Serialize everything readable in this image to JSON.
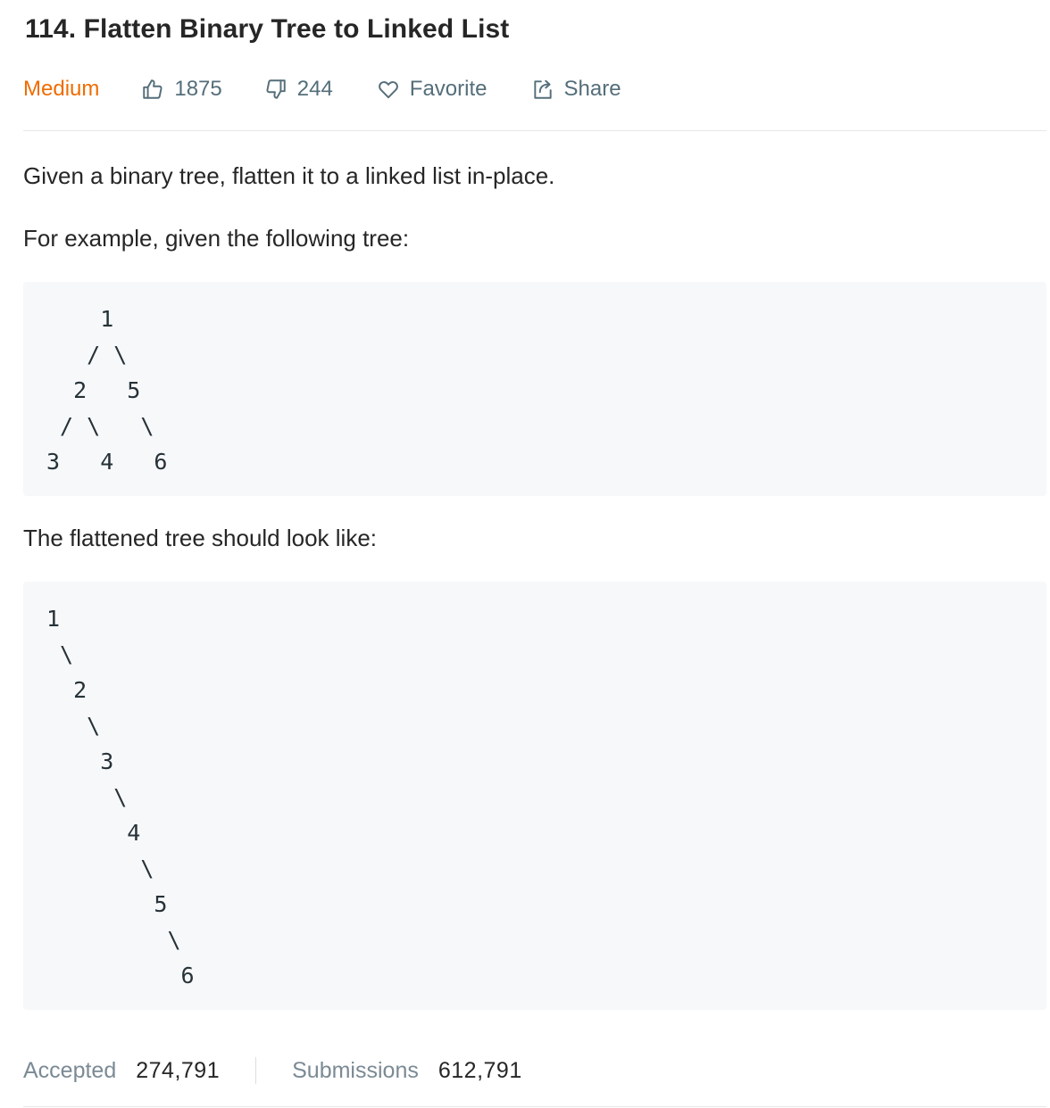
{
  "problem": {
    "title": "114. Flatten Binary Tree to Linked List",
    "difficulty": "Medium",
    "likes": "1875",
    "dislikes": "244",
    "favorite_label": "Favorite",
    "share_label": "Share",
    "icons": {
      "like": "thumbs-up-icon",
      "dislike": "thumbs-down-icon",
      "favorite": "heart-icon",
      "share": "share-icon"
    },
    "colors": {
      "difficulty": "#ef6c00",
      "meta": "#546e7a",
      "code_bg": "#f7f8fa"
    }
  },
  "description": {
    "intro": "Given a binary tree, flatten it to a linked list in-place.",
    "example_intro": "For example, given the following tree:",
    "example_tree": "    1\n   / \\\n  2   5\n / \\   \\\n3   4   6",
    "flattened_intro": "The flattened tree should look like:",
    "flattened_tree": "1\n \\\n  2\n   \\\n    3\n     \\\n      4\n       \\\n        5\n         \\\n          6"
  },
  "stats": {
    "accepted_label": "Accepted",
    "accepted_value": "274,791",
    "submissions_label": "Submissions",
    "submissions_value": "612,791"
  }
}
